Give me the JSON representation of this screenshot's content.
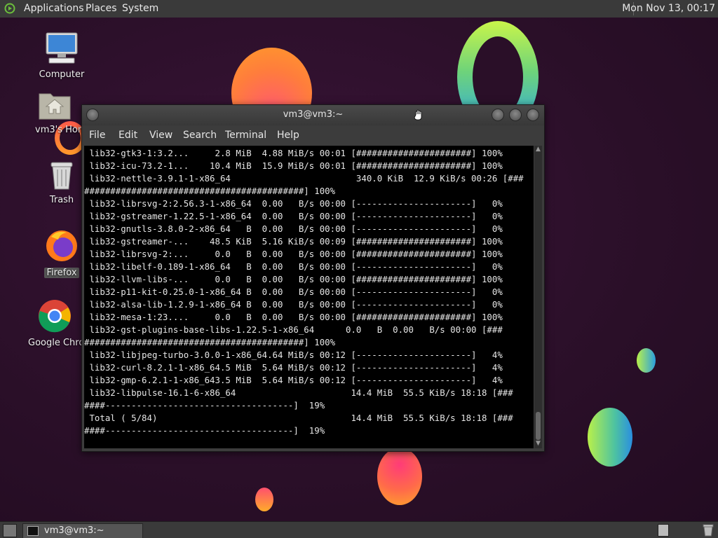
{
  "top_panel": {
    "menus": [
      "Applications",
      "Places",
      "System"
    ],
    "clock": "Mon Nov 13, 00:17"
  },
  "desktop": {
    "icons": [
      {
        "label": "Computer",
        "icon": "computer-icon"
      },
      {
        "label": "vm3's Home",
        "icon": "home-folder-icon"
      },
      {
        "label": "Trash",
        "icon": "trash-icon"
      },
      {
        "label": "Firefox",
        "icon": "firefox-icon"
      },
      {
        "label": "Google Chrome",
        "icon": "chrome-icon"
      }
    ]
  },
  "terminal": {
    "title": "vm3@vm3:~",
    "menu": [
      "File",
      "Edit",
      "View",
      "Search",
      "Terminal",
      "Help"
    ],
    "lines": [
      " lib32-gtk3-1:3.2...     2.8 MiB  4.88 MiB/s 00:01 [######################] 100%",
      " lib32-icu-73.2-1...    10.4 MiB  15.9 MiB/s 00:01 [######################] 100%",
      " lib32-nettle-3.9.1-1-x86_64                        340.0 KiB  12.9 KiB/s 00:26 [###",
      "##########################################] 100%",
      " lib32-librsvg-2:2.56.3-1-x86_64  0.00   B/s 00:00 [----------------------]   0%",
      " lib32-gstreamer-1.22.5-1-x86_64  0.00   B/s 00:00 [----------------------]   0%",
      " lib32-gnutls-3.8.0-2-x86_64   B  0.00   B/s 00:00 [----------------------]   0%",
      " lib32-gstreamer-...    48.5 KiB  5.16 KiB/s 00:09 [######################] 100%",
      " lib32-librsvg-2:...     0.0   B  0.00   B/s 00:00 [######################] 100%",
      " lib32-libelf-0.189-1-x86_64   B  0.00   B/s 00:00 [----------------------]   0%",
      " lib32-llvm-libs-...     0.0   B  0.00   B/s 00:00 [######################] 100%",
      " lib32-p11-kit-0.25.0-1-x86_64 B  0.00   B/s 00:00 [----------------------]   0%",
      " lib32-alsa-lib-1.2.9-1-x86_64 B  0.00   B/s 00:00 [----------------------]   0%",
      " lib32-mesa-1:23....     0.0   B  0.00   B/s 00:00 [######################] 100%",
      " lib32-gst-plugins-base-libs-1.22.5-1-x86_64      0.0   B  0.00   B/s 00:00 [###",
      "##########################################] 100%",
      " lib32-libjpeg-turbo-3.0.0-1-x86_64.64 MiB/s 00:12 [----------------------]   4%",
      " lib32-curl-8.2.1-1-x86_64.5 MiB  5.64 MiB/s 00:12 [----------------------]   4%",
      " lib32-gmp-6.2.1-1-x86_643.5 MiB  5.64 MiB/s 00:12 [----------------------]   4%",
      " lib32-libpulse-16.1-6-x86_64                      14.4 MiB  55.5 KiB/s 18:18 [###",
      "####------------------------------------]  19%",
      " Total ( 5/84)                                     14.4 MiB  55.5 KiB/s 18:18 [###",
      "####------------------------------------]  19%"
    ]
  },
  "taskbar": {
    "task_label": "vm3@vm3:~"
  }
}
